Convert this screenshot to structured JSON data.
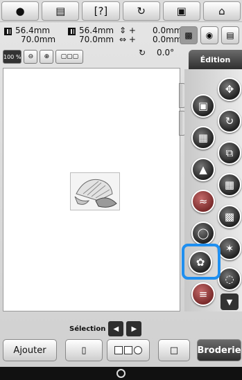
{
  "toolbar": {
    "items": [
      {
        "name": "camera-icon",
        "glyph": "◘"
      },
      {
        "name": "document-icon",
        "glyph": "▤"
      },
      {
        "name": "help-icon",
        "glyph": "?"
      },
      {
        "name": "thread-tension-icon",
        "glyph": "⟳"
      },
      {
        "name": "lock-icon",
        "glyph": "⌂"
      },
      {
        "name": "home-icon",
        "glyph": "⌂"
      }
    ]
  },
  "info": {
    "size1_w": "56.4mm",
    "size1_h": "70.0mm",
    "size2_w": "56.4mm",
    "size2_h": "70.0mm",
    "offset_v": "0.0mm",
    "offset_h": "0.0mm",
    "rotation": "0.0°",
    "zoom": "100 %"
  },
  "right_panel": {
    "tab_label": "Édition"
  },
  "selection": {
    "label": "Sélection"
  },
  "bottom": {
    "add_label": "Ajouter",
    "broderie_label": "Broderie"
  },
  "colors": {
    "highlight": "#1f8ff0"
  }
}
